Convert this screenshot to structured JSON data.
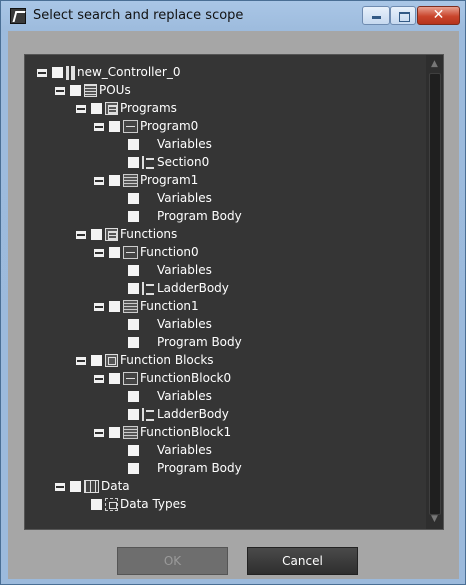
{
  "window": {
    "title": "Select search and replace scope",
    "close_glyph": "✕"
  },
  "tree": {
    "nodes": {
      "controller": "new_Controller_0",
      "pous": "POUs",
      "programs": "Programs",
      "program0": "Program0",
      "program0_variables": "Variables",
      "program0_section": "Section0",
      "program1": "Program1",
      "program1_variables": "Variables",
      "program1_body": "Program Body",
      "functions": "Functions",
      "function0": "Function0",
      "function0_variables": "Variables",
      "function0_ladder": "LadderBody",
      "function1": "Function1",
      "function1_variables": "Variables",
      "function1_body": "Program Body",
      "function_blocks": "Function Blocks",
      "functionblock0": "FunctionBlock0",
      "functionblock0_variables": "Variables",
      "functionblock0_ladder": "LadderBody",
      "functionblock1": "FunctionBlock1",
      "functionblock1_variables": "Variables",
      "functionblock1_body": "Program Body",
      "data": "Data",
      "data_types": "Data Types"
    }
  },
  "buttons": {
    "ok": "OK",
    "cancel": "Cancel"
  }
}
